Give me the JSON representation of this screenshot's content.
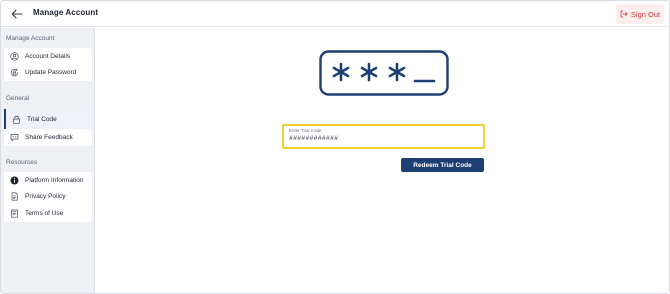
{
  "header": {
    "title": "Manage Account",
    "back_icon": "arrow-left-icon",
    "signout_label": "Sign Out",
    "signout_icon": "sign-out-icon",
    "signout_color": "#c8363a"
  },
  "sidebar": {
    "sections": [
      {
        "title": "Manage Account",
        "items": [
          {
            "label": "Account Details",
            "icon": "user-circle-icon"
          },
          {
            "label": "Update Password",
            "icon": "lock-rotate-icon"
          }
        ]
      },
      {
        "title": "General",
        "items": [
          {
            "label": "Trial Code",
            "icon": "lock-icon",
            "active": true
          },
          {
            "label": "Share Feedback",
            "icon": "feedback-icon"
          }
        ]
      },
      {
        "title": "Resources",
        "items": [
          {
            "label": "Platform Information",
            "icon": "info-icon"
          },
          {
            "label": "Privacy Policy",
            "icon": "document-icon"
          },
          {
            "label": "Terms of Use",
            "icon": "terms-icon"
          }
        ]
      }
    ]
  },
  "main": {
    "illustration_icon": "password-code-icon",
    "trial_field": {
      "label": "Enter Trial Code",
      "value": "############"
    },
    "redeem_label": "Redeem Trial Code"
  },
  "colors": {
    "accent": "#1e3f73",
    "focus_border": "#f2cf2a"
  }
}
